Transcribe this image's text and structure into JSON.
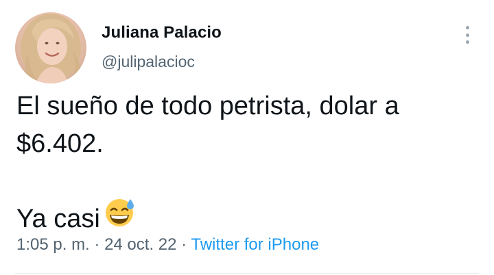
{
  "author": {
    "display_name": "Juliana Palacio",
    "username": "@julipalacioc"
  },
  "tweet": {
    "line1": "El sueño de todo petrista, dolar a",
    "line2": "$6.402.",
    "line3": "Ya casi",
    "emoji": "grinning-face-with-sweat"
  },
  "meta": {
    "time": "1:05 p. m.",
    "sep1": " · ",
    "date": "24 oct. 22",
    "sep2": " · ",
    "source": "Twitter for iPhone"
  },
  "icons": {
    "more": "more-options-icon"
  },
  "colors": {
    "text": "#0f1419",
    "secondary": "#536471",
    "link": "#1d9bf0"
  }
}
